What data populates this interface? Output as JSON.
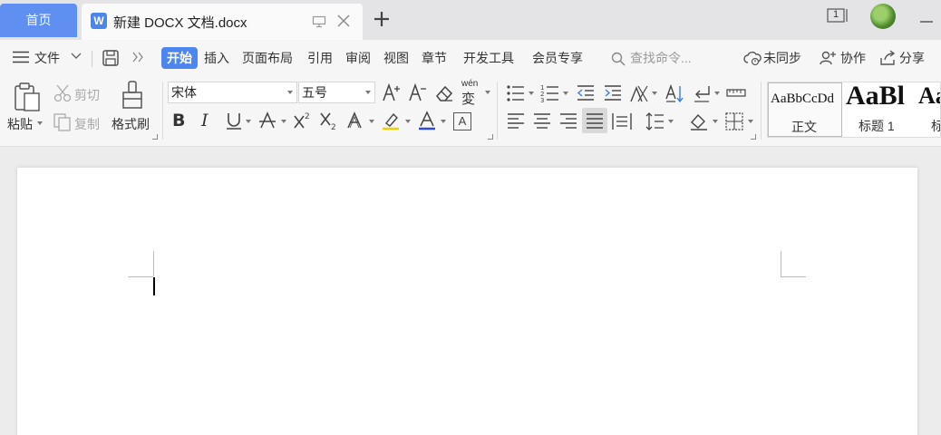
{
  "tabs": {
    "home_label": "首页",
    "doc_badge": "W",
    "doc_title": "新建 DOCX 文档.docx"
  },
  "window": {
    "page_count_badge": "1"
  },
  "menu": {
    "file_label": "文件",
    "items": [
      "开始",
      "插入",
      "页面布局",
      "引用",
      "审阅",
      "视图",
      "章节",
      "开发工具",
      "会员专享"
    ],
    "active_index": 0,
    "search_placeholder": "查找命令...",
    "sync_label": "未同步",
    "collab_label": "协作",
    "share_label": "分享"
  },
  "clipboard": {
    "paste_label": "粘贴",
    "cut_label": "剪切",
    "copy_label": "复制",
    "format_painter_label": "格式刷"
  },
  "font": {
    "family": "宋体",
    "size": "五号",
    "pinyin_glyph": "wén",
    "pinyin_char": "変",
    "char_border_glyph": "A"
  },
  "styles": {
    "normal_sample": "AaBbCcDd",
    "normal_label": "正文",
    "heading1_sample": "AaBl",
    "heading1_label": "标题 1",
    "heading2_sample": "Aa",
    "heading2_label": "标"
  },
  "colors": {
    "accent": "#4c86ee",
    "home_tab": "#5f8ff0",
    "font_color_bar": "#2f4bd8",
    "highlight_bar": "#f0d000"
  }
}
